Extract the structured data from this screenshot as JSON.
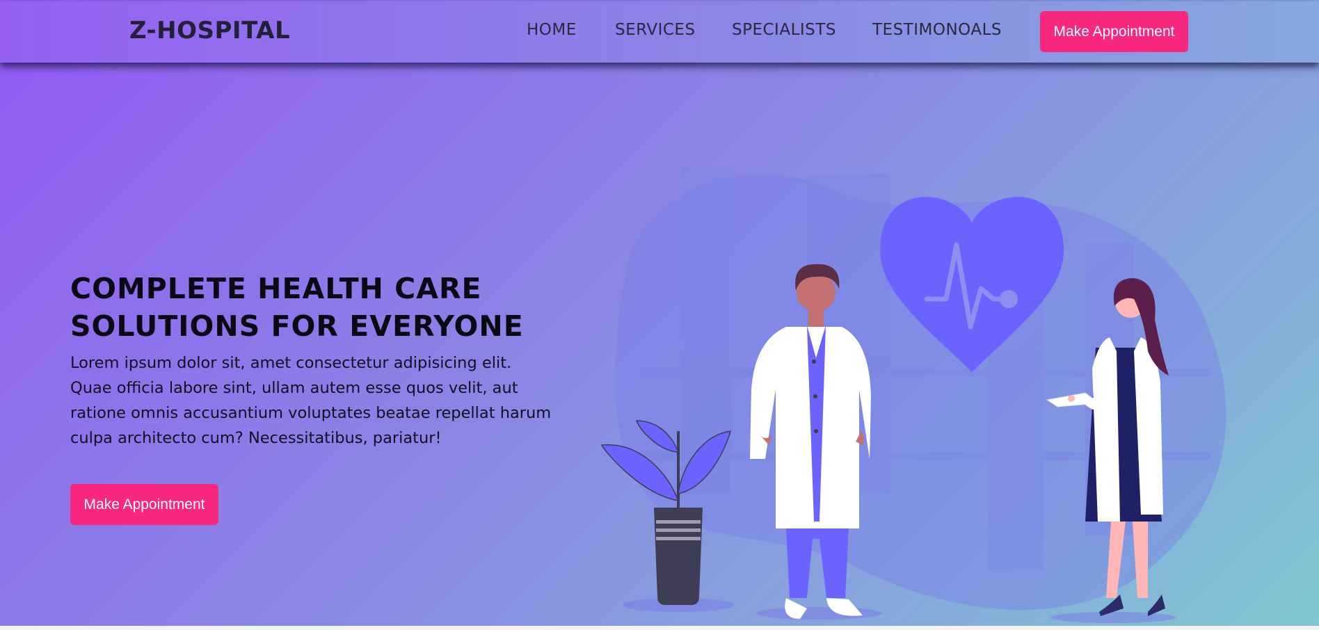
{
  "header": {
    "brand": "Z-HOSPITAL",
    "nav": [
      {
        "label": "HOME"
      },
      {
        "label": "SERVICES"
      },
      {
        "label": "SPECIALISTS"
      },
      {
        "label": "TESTIMONOALS"
      }
    ],
    "cta_label": "Make Appointment"
  },
  "hero": {
    "title_line1": "COMPLETE HEALTH CARE",
    "title_line2": "SOLUTIONS FOR EVERYONE",
    "description": "Lorem ipsum dolor sit, amet consectetur adipisicing elit. Quae officia labore sint, ullam autem esse quos velit, aut ratione omnis accusantium voluptates beatae repellat harum culpa architecto cum? Necessitatibus, pariatur!",
    "cta_label": "Make Appointment"
  },
  "illustration": {
    "name": "doctors-illustration",
    "icons": [
      "heart-pulse-icon",
      "plant-pot",
      "male-doctor",
      "female-doctor"
    ]
  },
  "colors": {
    "accent": "#f8287e",
    "brand_text": "#23203a",
    "gradient_start": "#9359f3",
    "gradient_end": "#80c8d1",
    "illustration_blue": "#6c63ff"
  }
}
